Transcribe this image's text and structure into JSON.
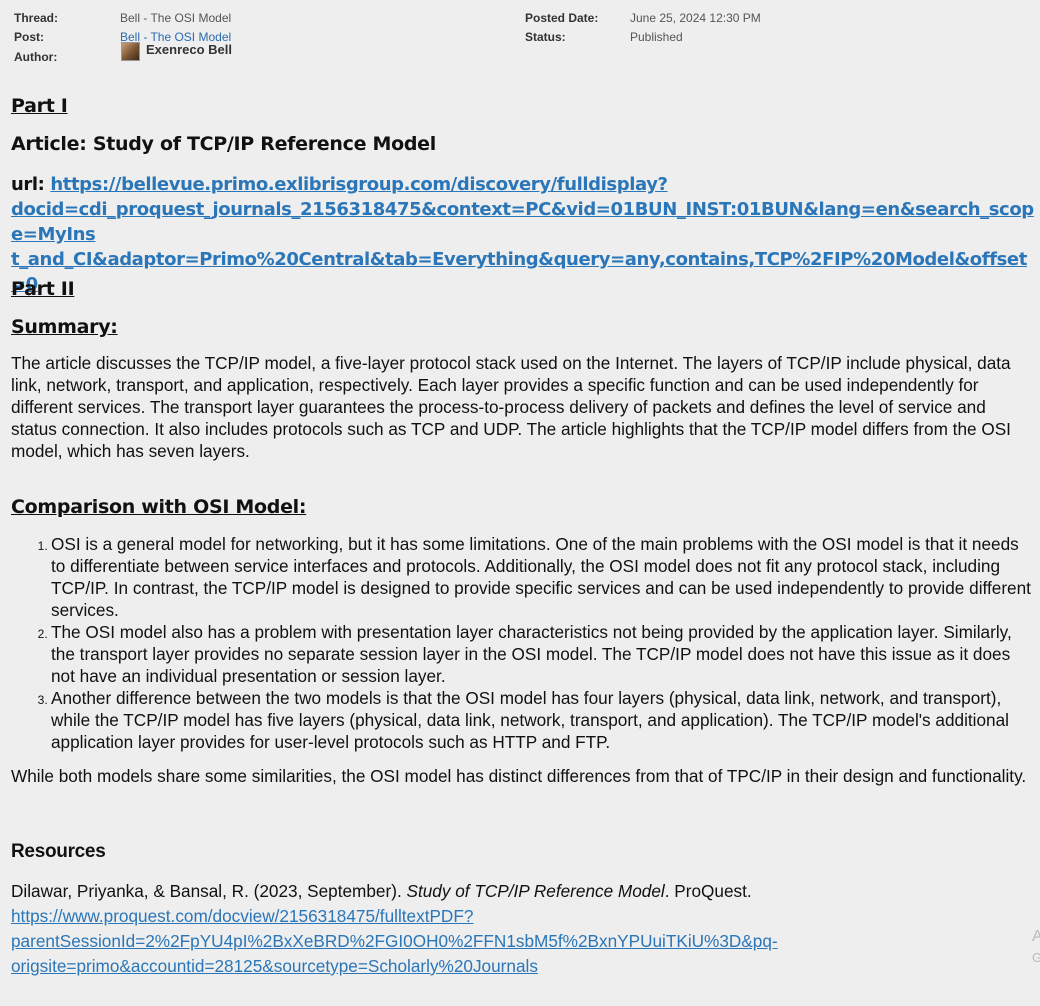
{
  "meta": {
    "thread_label": "Thread:",
    "thread_value": "Bell - The OSI Model",
    "post_label": "Post:",
    "post_value": "Bell - The OSI Model",
    "author_label": "Author:",
    "author_name": "Exenreco Bell",
    "posted_date_label": "Posted Date:",
    "posted_date_value": "June 25, 2024 12:30 PM",
    "status_label": "Status:",
    "status_value": "Published"
  },
  "part1": {
    "heading": "Part I",
    "article": "Article: Study of TCP/IP Reference Model",
    "url_label": "url: ",
    "url_line1": "https://bellevue.primo.exlibrisgroup.com/discovery/fulldisplay?",
    "url_line2": "docid=cdi_proquest_journals_2156318475&context=PC&vid=01BUN_INST:01BUN&lang=en&search_scope=MyIns",
    "url_line3": "t_and_CI&adaptor=Primo%20Central&tab=Everything&query=any,contains,TCP%2FIP%20Model&offset=0"
  },
  "part2": {
    "heading": "Part II",
    "summary_heading": "Summary:",
    "summary": "The article discusses the TCP/IP model, a five-layer protocol stack used on the Internet. The layers of TCP/IP include physical, data link, network, transport, and application, respectively. Each layer provides a specific function and can be used independently for different services. The transport layer guarantees the process-to-process delivery of packets and defines the level of service and status connection. It also includes protocols such as TCP and UDP. The article highlights that the TCP/IP model differs from the OSI model, which has seven layers.",
    "comparison_heading": "Comparison with OSI Model:",
    "items": [
      "OSI is a general model for networking, but it has some limitations. One of the main problems with the OSI model is that it needs to differentiate between service interfaces and protocols. Additionally, the OSI model does not fit any protocol stack, including TCP/IP. In contrast, the TCP/IP model is designed to provide specific services and can be used independently to provide different services.",
      "The OSI model also has a problem with presentation layer characteristics not being provided by the application layer. Similarly, the transport layer provides no separate session layer in the OSI model. The TCP/IP model does not have this issue as it does not have an individual presentation or session layer.",
      "Another difference between the two models is that the OSI model has four layers (physical, data link, network, and transport), while the TCP/IP model has five layers (physical, data link, network, transport, and application). The TCP/IP model's additional application layer provides for user-level protocols such as HTTP and FTP."
    ],
    "conclusion": "While both models share some similarities, the OSI model has distinct differences from that of TPC/IP in their design and functionality."
  },
  "resources": {
    "heading": "Resources",
    "citation_prefix": "Dilawar, Priyanka, & Bansal, R. (2023, September). ",
    "citation_title": "Study of TCP/IP Reference Model",
    "citation_suffix": ". ProQuest.",
    "link_line1": "https://www.proquest.com/docview/2156318475/fulltextPDF?",
    "link_line2": "parentSessionId=2%2FpYU4pI%2BxXeBRD%2FGI0OH0%2FFN1sbM5f%2BxnYPUuiTKiU%3D&pq-",
    "link_line3": "origsite=primo&accountid=28125&sourcetype=Scholarly%20Journals"
  },
  "edge": {
    "char1": "A",
    "char2": "G"
  }
}
